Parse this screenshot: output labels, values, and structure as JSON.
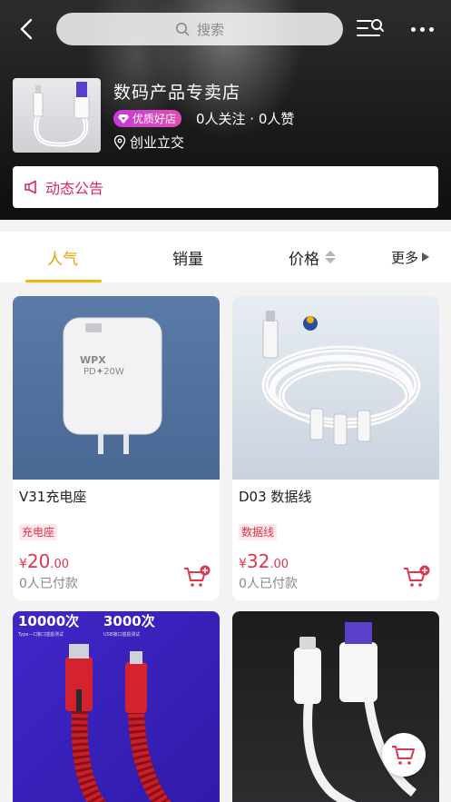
{
  "search": {
    "placeholder": "搜索"
  },
  "store": {
    "name": "数码产品专卖店",
    "badge": "优质好店",
    "stats": "0人关注 · 0人赞",
    "location": "创业立交"
  },
  "notice": {
    "label": "动态公告"
  },
  "tabs": [
    {
      "label": "人气",
      "active": true
    },
    {
      "label": "销量",
      "active": false
    },
    {
      "label": "价格",
      "active": false
    },
    {
      "label": "更多",
      "active": false
    }
  ],
  "products": [
    {
      "title": "V31充电座",
      "tag": "充电座",
      "currency": "¥",
      "price_int": "20",
      "price_dec": ".00",
      "paid": "0人已付款",
      "image_text": "PD✦20W"
    },
    {
      "title": "D03 数据线",
      "tag": "数据线",
      "currency": "¥",
      "price_int": "32",
      "price_dec": ".00",
      "paid": "0人已付款"
    },
    {
      "title": "",
      "image_text_1": "10000次",
      "image_text_2": "3000次",
      "image_sub_1": "Type－C接口插拔测试",
      "image_sub_2": "USB接口插拔测试"
    },
    {
      "title": ""
    }
  ],
  "colors": {
    "accent_tab": "#f2b500",
    "price": "#e0354d",
    "notice": "#d8266b",
    "badge_start": "#c63bd8",
    "badge_end": "#e24fb1"
  },
  "icons": [
    "back-icon",
    "search-icon",
    "filter-list-icon",
    "more-icon",
    "diamond-icon",
    "location-pin-icon",
    "megaphone-icon",
    "cart-add-icon",
    "cart-icon"
  ]
}
